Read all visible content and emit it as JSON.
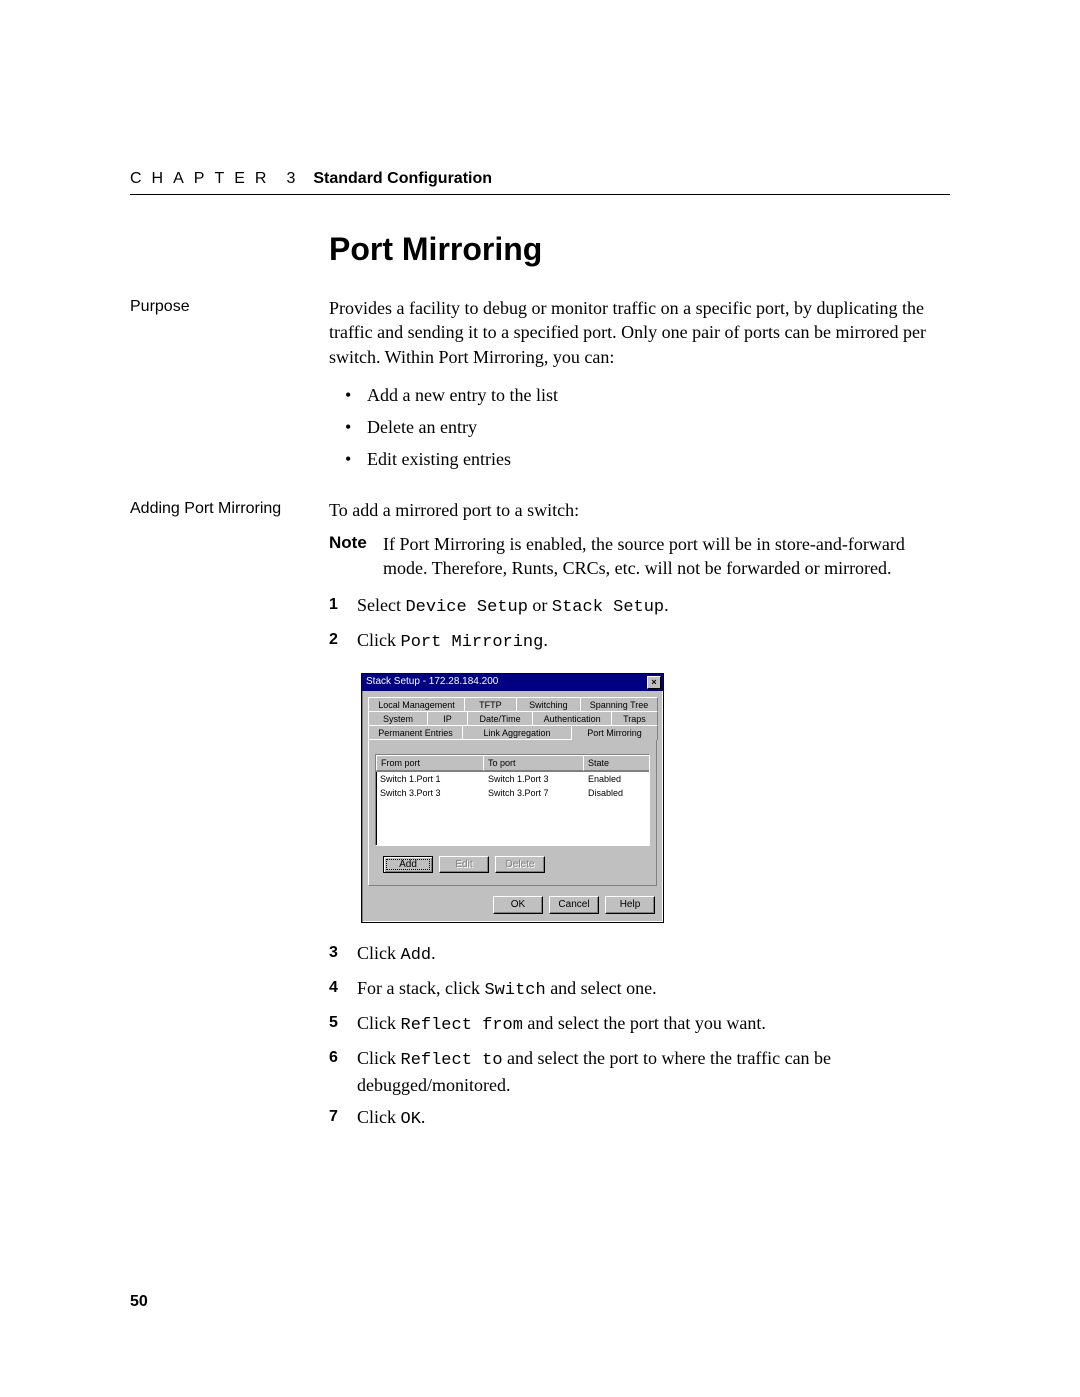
{
  "header": {
    "chapter_label": "CHAPTER",
    "chapter_num": "3",
    "section": "Standard Configuration"
  },
  "title": "Port Mirroring",
  "purpose": {
    "label": "Purpose",
    "text": "Provides a facility to debug or monitor traffic on a specific port, by duplicating the traffic and sending it to a specified port. Only one pair of ports can be mirrored per switch. Within Port Mirroring, you can:",
    "bullets": [
      "Add a new entry to the list",
      "Delete an entry",
      "Edit existing entries"
    ]
  },
  "adding": {
    "label": "Adding Port Mirroring",
    "intro": "To add a mirrored port to a switch:",
    "note_label": "Note",
    "note_text": "If Port Mirroring is enabled, the source port will be in store-and-forward mode. Therefore, Runts, CRCs, etc. will not be forwarded or mirrored.",
    "steps": {
      "s1_a": "Select ",
      "s1_b": "Device Setup",
      "s1_c": " or ",
      "s1_d": "Stack Setup",
      "s1_e": ".",
      "s2_a": "Click ",
      "s2_b": "Port Mirroring",
      "s2_c": ".",
      "s3_a": "Click ",
      "s3_b": "Add",
      "s3_c": ".",
      "s4_a": "For a stack, click ",
      "s4_b": "Switch",
      "s4_c": " and select one.",
      "s5_a": "Click ",
      "s5_b": "Reflect from",
      "s5_c": " and select the port that you want.",
      "s6_a": "Click ",
      "s6_b": "Reflect to",
      "s6_c": " and select the port to where the traffic can be debugged/monitored.",
      "s7_a": "Click ",
      "s7_b": "OK",
      "s7_c": "."
    }
  },
  "dialog": {
    "title": "Stack Setup - 172.28.184.200",
    "close_glyph": "×",
    "tabs_row1": [
      "Local Management",
      "TFTP",
      "Switching",
      "Spanning Tree"
    ],
    "tabs_row2": [
      "System",
      "IP",
      "Date/Time",
      "Authentication",
      "Traps"
    ],
    "tabs_row3": [
      "Permanent Entries",
      "Link Aggregation",
      "Port Mirroring"
    ],
    "headers": {
      "from": "From port",
      "to": "To port",
      "state": "State"
    },
    "rows": [
      {
        "from": "Switch 1.Port 1",
        "to": "Switch 1.Port 3",
        "state": "Enabled"
      },
      {
        "from": "Switch 3.Port 3",
        "to": "Switch 3.Port 7",
        "state": "Disabled"
      }
    ],
    "buttons": {
      "add": "Add",
      "edit": "Edit",
      "delete": "Delete",
      "ok": "OK",
      "cancel": "Cancel",
      "help": "Help"
    }
  },
  "page_number": "50"
}
